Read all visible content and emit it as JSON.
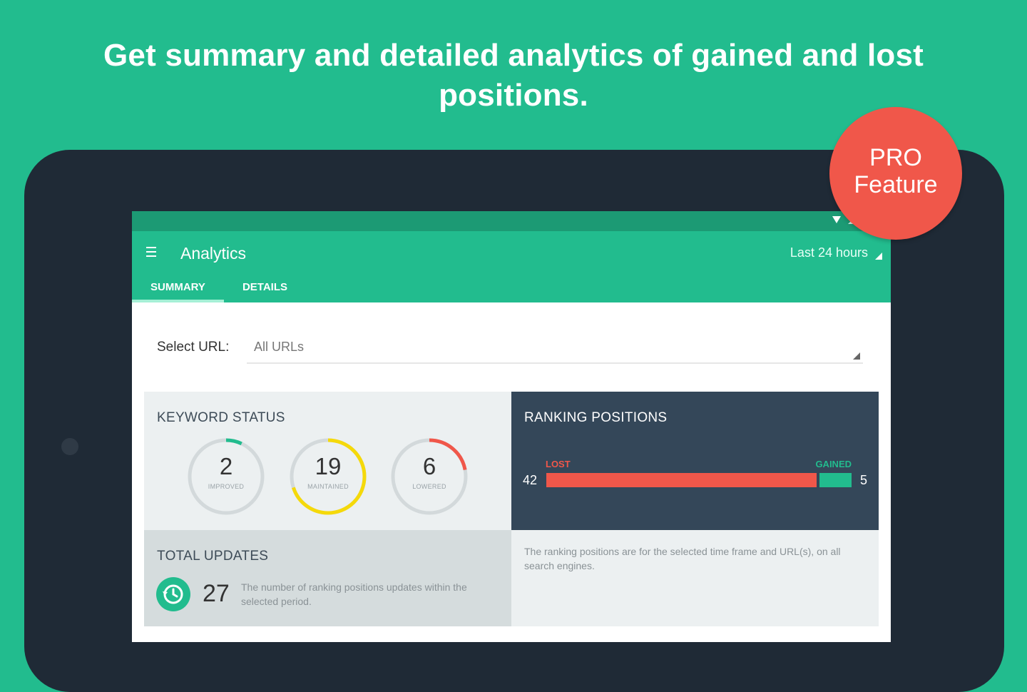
{
  "headline": "Get summary and detailed analytics of gained and lost positions.",
  "badge": {
    "line1": "PRO",
    "line2": "Feature",
    "color": "#f0574a"
  },
  "colors": {
    "brand": "#22bc8e",
    "dark_card": "#344759",
    "lost": "#f0574a",
    "maintained": "#f5d90a"
  },
  "app": {
    "title": "Analytics",
    "time_range": "Last 24 hours",
    "tabs": [
      {
        "label": "SUMMARY",
        "active": true
      },
      {
        "label": "DETAILS",
        "active": false
      }
    ]
  },
  "url_select": {
    "label": "Select URL:",
    "value": "All URLs"
  },
  "keyword_status": {
    "title": "KEYWORD STATUS",
    "items": [
      {
        "value": "2",
        "label": "IMPROVED",
        "color": "#22bc8e",
        "fraction": 0.07
      },
      {
        "value": "19",
        "label": "MAINTAINED",
        "color": "#f5d90a",
        "fraction": 0.7
      },
      {
        "value": "6",
        "label": "LOWERED",
        "color": "#f0574a",
        "fraction": 0.22
      }
    ]
  },
  "ranking_positions": {
    "title": "RANKING POSITIONS",
    "lost_label": "LOST",
    "gained_label": "GAINED",
    "lost": 42,
    "gained": 5,
    "note": "The ranking positions are for the selected time frame and URL(s), on all search engines."
  },
  "total_updates": {
    "title": "TOTAL UPDATES",
    "value": "27",
    "description": "The number of ranking positions updates within the selected period."
  }
}
